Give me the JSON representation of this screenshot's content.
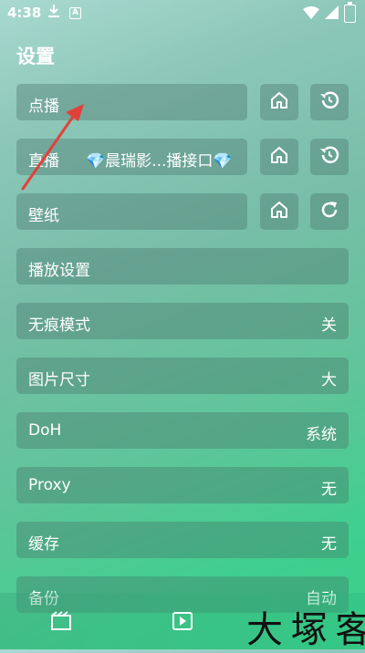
{
  "status_bar": {
    "time": "4:38",
    "a_icon": "A"
  },
  "page_title": "设置",
  "rows": {
    "vod": {
      "label": "点播"
    },
    "live": {
      "label": "直播",
      "gem1": "💎",
      "source": "晨瑞影...播接口",
      "gem2": "💎"
    },
    "wallpaper": {
      "label": "壁纸"
    },
    "playback": {
      "label": "播放设置"
    },
    "incognito": {
      "label": "无痕模式",
      "value": "关"
    },
    "image_size": {
      "label": "图片尺寸",
      "value": "大"
    },
    "doh": {
      "label": "DoH",
      "value": "系统"
    },
    "proxy": {
      "label": "Proxy",
      "value": "无"
    },
    "cache": {
      "label": "缓存",
      "value": "无"
    },
    "backup": {
      "label": "备份",
      "value": "自动"
    }
  },
  "icons": {
    "home": "home-icon",
    "history": "history-icon",
    "refresh": "refresh-icon",
    "film": "film-icon",
    "play": "play-icon",
    "wifi": "wifi-icon",
    "signal": "signal-icon",
    "battery": "battery-icon",
    "download": "download-icon"
  },
  "watermark": "大 塚 客",
  "colors": {
    "arrow": "#e2413a",
    "gem": "#5ec8f0"
  }
}
